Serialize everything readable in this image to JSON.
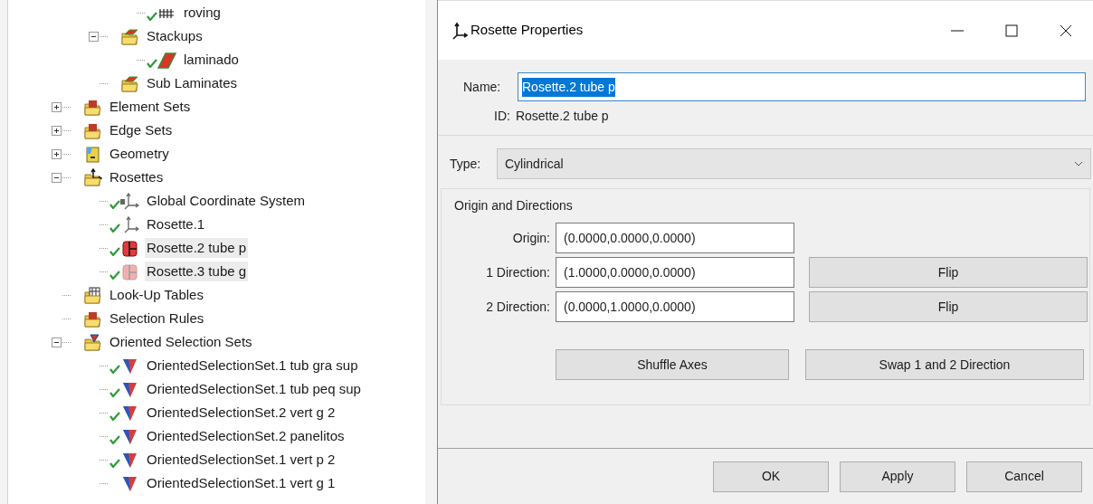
{
  "tree": [
    {
      "children": [
        {
          "children": [
            {
              "label": "roving",
              "kind": "fabric",
              "checked": true,
              "selected": false
            }
          ]
        },
        {
          "label": "Stackups",
          "kind": "ply-folder",
          "expanded": true,
          "selected": false,
          "children": [
            {
              "label": "laminado",
              "kind": "ply",
              "checked": true,
              "selected": false
            }
          ]
        },
        {
          "label": "Sub Laminates",
          "kind": "ply-folder",
          "selected": false
        }
      ]
    },
    {
      "label": "Element Sets",
      "kind": "folder",
      "expanded": false,
      "selected": false
    },
    {
      "label": "Edge Sets",
      "kind": "folder",
      "expanded": false,
      "selected": false
    },
    {
      "label": "Geometry",
      "kind": "geometry",
      "expanded": false,
      "selected": false
    },
    {
      "label": "Rosettes",
      "kind": "axes-folder",
      "expanded": true,
      "selected": false,
      "children": [
        {
          "label": "Global Coordinate System",
          "kind": "axes-locked",
          "checked": true,
          "selected": false
        },
        {
          "label": "Rosette.1",
          "kind": "axes",
          "checked": true,
          "selected": false
        },
        {
          "label": "Rosette.2 tube p",
          "kind": "cylinder",
          "checked": true,
          "selected": true
        },
        {
          "label": "Rosette.3 tube g",
          "kind": "cylinder-pale",
          "checked": true,
          "selected": true
        }
      ]
    },
    {
      "label": "Look-Up Tables",
      "kind": "table-folder",
      "selected": false
    },
    {
      "label": "Selection Rules",
      "kind": "folder",
      "selected": false
    },
    {
      "label": "Oriented Selection Sets",
      "kind": "oss-folder",
      "expanded": true,
      "selected": false,
      "children": [
        {
          "label": "OrientedSelectionSet.1 tub gra sup",
          "kind": "oss",
          "checked": true,
          "selected": false
        },
        {
          "label": "OrientedSelectionSet.1 tub peq sup",
          "kind": "oss",
          "checked": true,
          "selected": false
        },
        {
          "label": "OrientedSelectionSet.2 vert g 2",
          "kind": "oss",
          "checked": true,
          "selected": false
        },
        {
          "label": "OrientedSelectionSet.2 panelitos",
          "kind": "oss",
          "checked": true,
          "selected": false
        },
        {
          "label": "OrientedSelectionSet.1 vert p 2",
          "kind": "oss",
          "checked": true,
          "selected": false
        },
        {
          "label": "OrientedSelectionSet.1 vert g 1",
          "kind": "oss",
          "checked": false,
          "selected": false
        }
      ]
    }
  ],
  "dialog": {
    "title": "Rosette Properties",
    "name": {
      "label": "Name:",
      "value": "Rosette.2 tube p",
      "text_selected": true
    },
    "id": {
      "label": "ID:",
      "value": "Rosette.2 tube p"
    },
    "type": {
      "label": "Type:",
      "value": "Cylindrical"
    },
    "group": {
      "title": "Origin and Directions",
      "rows": [
        {
          "label": "Origin:",
          "value": "(0.0000,0.0000,0.0000)"
        },
        {
          "label": "1 Direction:",
          "value": "(1.0000,0.0000,0.0000)",
          "button": "Flip"
        },
        {
          "label": "2 Direction:",
          "value": "(0.0000,1.0000,0.0000)",
          "button": "Flip"
        }
      ],
      "actions": [
        "Shuffle Axes",
        "Swap 1 and 2 Direction"
      ]
    },
    "buttons": [
      "OK",
      "Apply",
      "Cancel"
    ]
  }
}
